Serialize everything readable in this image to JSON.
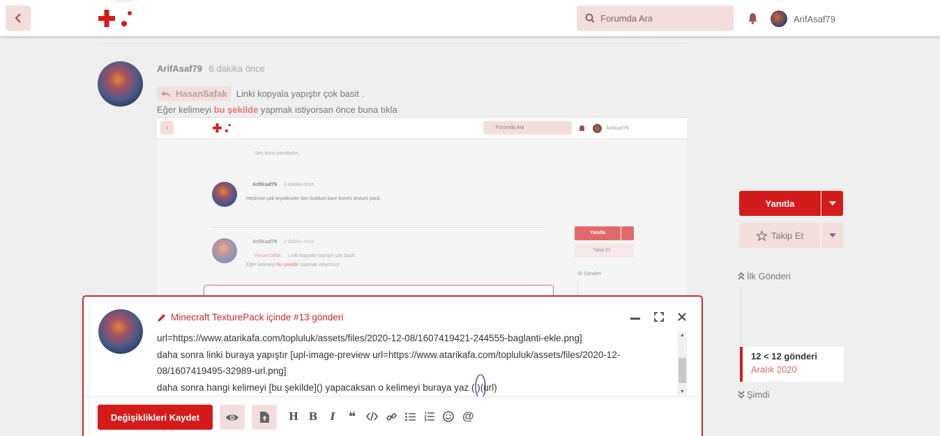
{
  "header": {
    "search_placeholder": "Forumda Ara",
    "username": "ArifAsaf79"
  },
  "post": {
    "author": "ArifAsaf79",
    "time": "6 dakika önce",
    "mention": "HasanSafak",
    "quote_text": "Linki kopyala yapıştır çok basit .",
    "line2_prefix": "Eğer kelimeyi ",
    "line2_link": "bu şekilde",
    "line2_suffix": " yapmak istiyorsan önce buna tıkla"
  },
  "embedded": {
    "search": "Forumda Ara",
    "user": "ArifAsaf79",
    "replied": "Sen bunu yanıtladın.",
    "p1_author": "ArifAsaf79",
    "p1_time": "3 dakika önce",
    "p1_text": "Hepinize çok teşekkürler ben buldum bare bones texture pack.",
    "p2_author": "ArifAsaf79",
    "p2_time": "2 dakika önce",
    "p2_mention": "HasanSafak",
    "p2_text": "Linki kopyala yapıştır çok basit .",
    "p2_line2a": "Eğer kelimeyi ",
    "p2_line2b": "bu şekilde",
    "p2_line2c": " yapmak istiyorsun",
    "reply": "Yanıtla",
    "follow": "Takip Et",
    "first": "İlk Gönderi"
  },
  "sidebar": {
    "reply_label": "Yanıtla",
    "follow_label": "Takip Et",
    "first_post": "İlk Gönderi",
    "position": "12 < 12 gönderi",
    "date": "Aralık 2020",
    "now": "Şimdi"
  },
  "composer": {
    "title": "Minecraft TexturePack içinde #13 gönderi",
    "lines": [
      "url=https://www.atarikafa.com/topluluk/assets/files/2020-12-08/1607419421-244555-baglanti-ekle.png]",
      "daha sonra linki buraya yapıştır [upl-image-preview url=https://www.atarikafa.com/topluluk/assets/files/2020-12-",
      "08/1607419495-32989-url.png]",
      "daha sonra hangi kelimeyi [bu şekilde]() yapacaksan o kelimeyi buraya yaz ( )(url)"
    ],
    "save_label": "Değişiklikleri Kaydet"
  },
  "colors": {
    "accent": "#d41b1b",
    "pink": "#f3dede"
  }
}
